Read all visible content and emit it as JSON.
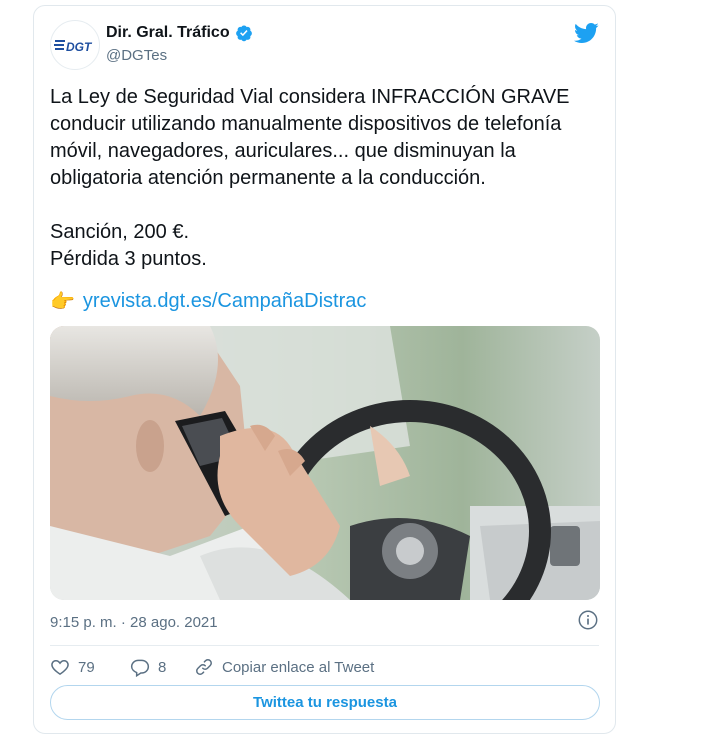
{
  "author": {
    "display_name": "Dir. Gral. Tráfico",
    "handle": "@DGTes",
    "logo_text": "DGT",
    "verified": true
  },
  "tweet": {
    "lines": [
      "La Ley de Seguridad Vial considera INFRACCIÓN GRAVE",
      "conducir utilizando manualmente dispositivos de telefonía",
      "móvil, navegadores, auriculares... que disminuyan la",
      "obligatoria atención permanente a la conducción.",
      "",
      "Sanción, 200 €.",
      "Pérdida 3 puntos.",
      ""
    ],
    "link_emoji": "👉",
    "link": "yrevista.dgt.es/CampañaDistrac",
    "timestamp": "9:15 p. m. · 28 ago. 2021"
  },
  "actions": {
    "likes": "79",
    "replies": "8",
    "copy_link": "Copiar enlace al Tweet"
  },
  "reply_button": "Twittea tu respuesta",
  "icons": {
    "bird": "twitter-bird-icon",
    "verified": "verified-badge-icon",
    "info": "info-icon",
    "like": "heart-icon",
    "reply": "reply-bubble-icon",
    "link": "link-icon"
  },
  "colors": {
    "brand_blue": "#1da1f2",
    "link_blue": "#1b95e0",
    "secondary_text": "#5b7083",
    "dgt_blue": "#1f4fa0"
  }
}
